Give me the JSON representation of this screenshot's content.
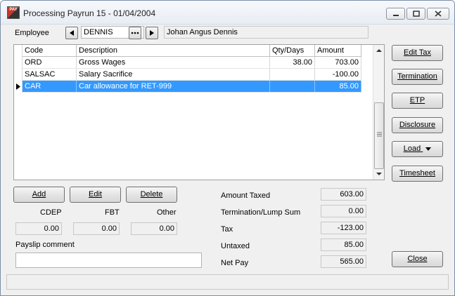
{
  "window": {
    "title": "Processing Payrun 15 - 01/04/2004",
    "app_icon_text": "PAY"
  },
  "employee": {
    "label": "Employee",
    "code": "DENNIS",
    "name": "Johan Angus Dennis"
  },
  "grid": {
    "columns": [
      "Code",
      "Description",
      "Qty/Days",
      "Amount"
    ],
    "rows": [
      {
        "code": "ORD",
        "description": "Gross Wages",
        "qty": "38.00",
        "amount": "703.00"
      },
      {
        "code": "SALSAC",
        "description": "Salary Sacrifice",
        "qty": "",
        "amount": "-100.00"
      },
      {
        "code": "CAR",
        "description": "Car allowance for RET-999",
        "qty": "",
        "amount": "85.00"
      }
    ]
  },
  "buttons": {
    "add": "Add",
    "edit": "Edit",
    "delete": "Delete",
    "edit_tax": "Edit Tax",
    "termination": "Termination",
    "etp": "ETP",
    "disclosure": "Disclosure",
    "load": "Load",
    "timesheet": "Timesheet",
    "close": "Close"
  },
  "deductions": {
    "cdep_label": "CDEP",
    "cdep_value": "0.00",
    "fbt_label": "FBT",
    "fbt_value": "0.00",
    "other_label": "Other",
    "other_value": "0.00"
  },
  "payslip": {
    "label": "Payslip comment",
    "value": ""
  },
  "summary": {
    "amount_taxed_label": "Amount Taxed",
    "amount_taxed": "603.00",
    "termination_label": "Termination/Lump Sum",
    "termination": "0.00",
    "tax_label": "Tax",
    "tax": "-123.00",
    "untaxed_label": "Untaxed",
    "untaxed": "85.00",
    "net_pay_label": "Net Pay",
    "net_pay": "565.00"
  },
  "colors": {
    "selection": "#3399ff",
    "window_bg": "#f0f0f0"
  }
}
